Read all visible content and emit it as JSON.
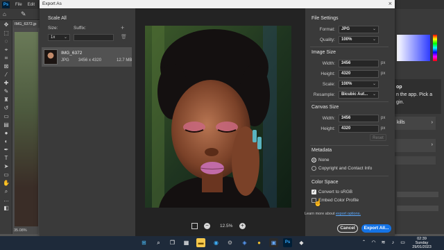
{
  "photoshop": {
    "menu": [
      "File",
      "Edit"
    ],
    "doc_tab": "IMG_6372.jp",
    "zoom": "35.08%",
    "learn_text_1": "op",
    "learn_text_2": "n the app. Pick a",
    "learn_text_3": "gin.",
    "learn_card_1": "kills",
    "learn_card_arrow": "›"
  },
  "dialog": {
    "title": "Export As",
    "close_icon": "×",
    "left": {
      "scale_all": "Scale All",
      "size_label": "Size:",
      "suffix_label": "Suffix:",
      "size_value": "1x",
      "file": {
        "name": "IMG_6372",
        "type": "JPG",
        "dims": "3456 x 4320",
        "size": "12.7 MB"
      }
    },
    "preview": {
      "zoom": "12.5%"
    },
    "file_settings": {
      "title": "File Settings",
      "format_label": "Format:",
      "format_value": "JPG",
      "quality_label": "Quality:",
      "quality_value": "100%"
    },
    "image_size": {
      "title": "Image Size",
      "width_label": "Width:",
      "width_value": "3456",
      "height_label": "Height:",
      "height_value": "4320",
      "scale_label": "Scale:",
      "scale_value": "100%",
      "resample_label": "Resample:",
      "resample_value": "Bicubic Aut...",
      "unit": "px"
    },
    "canvas_size": {
      "title": "Canvas Size",
      "width_label": "Width:",
      "width_value": "3456",
      "height_label": "Height:",
      "height_value": "4320",
      "unit": "px",
      "reset_label": "Reset"
    },
    "metadata": {
      "title": "Metadata",
      "option_none": "None",
      "option_copyright": "Copyright and Contact Info"
    },
    "color_space": {
      "title": "Color Space",
      "convert_label": "Convert to sRGB",
      "embed_label": "Embed Color Profile"
    },
    "learn_more_prefix": "Learn more about ",
    "learn_more_link": "export options.",
    "cancel_label": "Cancel",
    "export_label": "Export All..."
  },
  "taskbar": {
    "time": "02:39",
    "day": "Sunday",
    "date": "29/01/2023"
  },
  "colors": {
    "accent": "#1473e6",
    "link": "#5aa9ff",
    "dialog_bg": "#3a3a3a",
    "preview_bg": "#232323"
  }
}
